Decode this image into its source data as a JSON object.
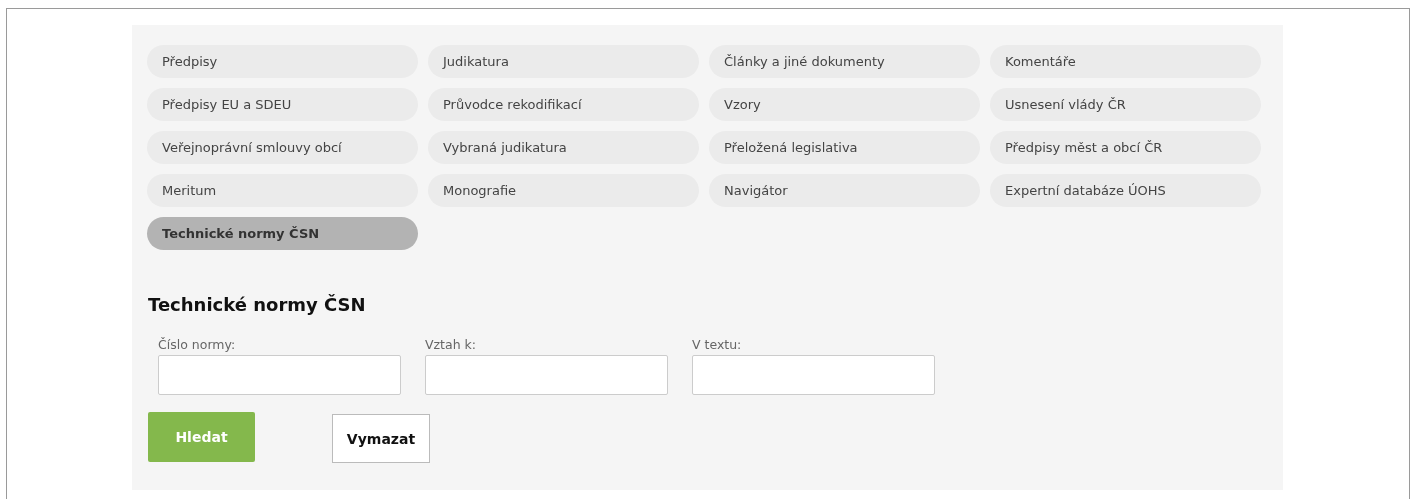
{
  "categories": [
    {
      "label": "Předpisy",
      "selected": false
    },
    {
      "label": "Judikatura",
      "selected": false
    },
    {
      "label": "Články a jiné dokumenty",
      "selected": false
    },
    {
      "label": "Komentáře",
      "selected": false
    },
    {
      "label": "Předpisy EU a SDEU",
      "selected": false
    },
    {
      "label": "Průvodce rekodifikací",
      "selected": false
    },
    {
      "label": "Vzory",
      "selected": false
    },
    {
      "label": "Usnesení vlády ČR",
      "selected": false
    },
    {
      "label": "Veřejnoprávní smlouvy obcí",
      "selected": false
    },
    {
      "label": "Vybraná judikatura",
      "selected": false
    },
    {
      "label": "Přeložená legislativa",
      "selected": false
    },
    {
      "label": "Předpisy měst a obcí ČR",
      "selected": false
    },
    {
      "label": "Meritum",
      "selected": false
    },
    {
      "label": "Monografie",
      "selected": false
    },
    {
      "label": "Navigátor",
      "selected": false
    },
    {
      "label": "Expertní databáze ÚOHS",
      "selected": false
    },
    {
      "label": "Technické normy ČSN",
      "selected": true
    }
  ],
  "section_title": "Technické normy ČSN",
  "fields": [
    {
      "label": "Číslo normy:"
    },
    {
      "label": "Vztah k:"
    },
    {
      "label": "V textu:"
    }
  ],
  "buttons": [
    {
      "label": "Hledat",
      "kind": "primary"
    },
    {
      "label": "Vymazat",
      "kind": "secondary"
    }
  ]
}
